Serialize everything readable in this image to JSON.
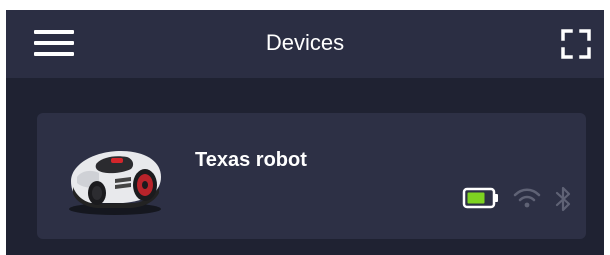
{
  "header": {
    "title": "Devices",
    "menu_icon": "hamburger-menu-icon",
    "fullscreen_icon": "fullscreen-icon"
  },
  "devices": [
    {
      "name": "Texas robot",
      "image": "robot-lawnmower",
      "status": {
        "battery_icon": "battery-icon",
        "battery_color": "#7ed321",
        "wifi_icon": "wifi-icon",
        "wifi_active": false,
        "bluetooth_icon": "bluetooth-icon",
        "bluetooth_active": false
      }
    }
  ],
  "colors": {
    "header_bg": "#2b2e43",
    "page_bg": "#1f2232",
    "card_bg": "#2d3045",
    "text": "#ffffff",
    "inactive_icon": "#5f6275"
  }
}
